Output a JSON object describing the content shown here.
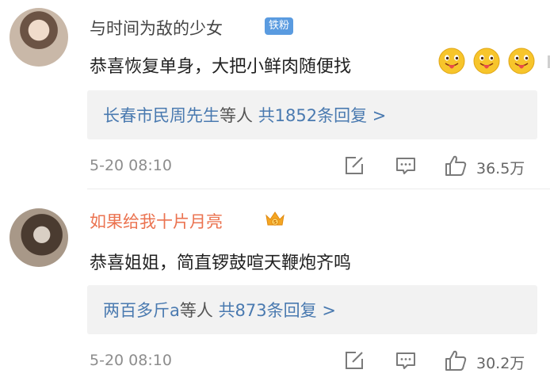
{
  "comments": [
    {
      "username": "与时间为敌的少女",
      "badge": "铁粉",
      "text": "恭喜恢复单身，大把小鲜肉随便找",
      "emoji_icon": "tongue-out-emoji-icon",
      "emoji_count": 3,
      "reply_users": "长春市民周先生",
      "reply_suffix": "等人",
      "reply_count": "共1852条回复 >",
      "date": "5-20 08:10",
      "likes": "36.5万"
    },
    {
      "username": "如果给我十片月亮",
      "badge_icon": "crown-icon",
      "text": "恭喜姐姐，简直锣鼓喧天鞭炮齐鸣",
      "reply_users": "两百多斤a",
      "reply_suffix": "等人",
      "reply_count": "共873条回复 >",
      "date": "5-20 08:10",
      "likes": "30.2万"
    }
  ],
  "colors": {
    "link_blue": "#4a7ab0",
    "vip_name": "#eb7350",
    "fan_badge": "#5a9be0",
    "meta_gray": "#8d8d8d"
  }
}
